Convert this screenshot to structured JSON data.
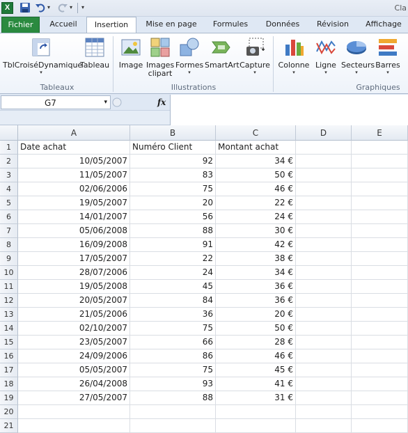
{
  "app": {
    "window_title_fragment": "Cla",
    "excel_icon_letter": "X"
  },
  "tabs": [
    {
      "label": "Fichier"
    },
    {
      "label": "Accueil"
    },
    {
      "label": "Insertion"
    },
    {
      "label": "Mise en page"
    },
    {
      "label": "Formules"
    },
    {
      "label": "Données"
    },
    {
      "label": "Révision"
    },
    {
      "label": "Affichage"
    }
  ],
  "ribbon": {
    "groups": {
      "tableaux": "Tableaux",
      "illustrations": "Illustrations",
      "graphiques": "Graphiques"
    },
    "buttons": {
      "pivot": "TblCroiséDynamique",
      "table": "Tableau",
      "image": "Image",
      "clipart_1": "Images",
      "clipart_2": "clipart",
      "shapes": "Formes",
      "smartart": "SmartArt",
      "capture": "Capture",
      "column": "Colonne",
      "line": "Ligne",
      "pie": "Secteurs",
      "bars": "Barres"
    }
  },
  "formula_bar": {
    "name_box": "G7",
    "fx_label": "fx",
    "formula": ""
  },
  "sheet": {
    "columns": [
      "A",
      "B",
      "C",
      "D",
      "E"
    ],
    "header_row": [
      "Date achat",
      "Numéro Client",
      "Montant achat"
    ],
    "rows": [
      [
        "10/05/2007",
        "92",
        "34 €"
      ],
      [
        "11/05/2007",
        "83",
        "50 €"
      ],
      [
        "02/06/2006",
        "75",
        "46 €"
      ],
      [
        "19/05/2007",
        "20",
        "22 €"
      ],
      [
        "14/01/2007",
        "56",
        "24 €"
      ],
      [
        "05/06/2008",
        "88",
        "30 €"
      ],
      [
        "16/09/2008",
        "91",
        "42 €"
      ],
      [
        "17/05/2007",
        "22",
        "38 €"
      ],
      [
        "28/07/2006",
        "24",
        "34 €"
      ],
      [
        "19/05/2008",
        "45",
        "36 €"
      ],
      [
        "20/05/2007",
        "84",
        "36 €"
      ],
      [
        "21/05/2006",
        "36",
        "20 €"
      ],
      [
        "02/10/2007",
        "75",
        "50 €"
      ],
      [
        "23/05/2007",
        "66",
        "28 €"
      ],
      [
        "24/09/2006",
        "86",
        "46 €"
      ],
      [
        "05/05/2007",
        "75",
        "45 €"
      ],
      [
        "26/04/2008",
        "93",
        "41 €"
      ],
      [
        "27/05/2007",
        "88",
        "31 €"
      ]
    ],
    "row_numbers": [
      "1",
      "2",
      "3",
      "4",
      "5",
      "6",
      "7",
      "8",
      "9",
      "10",
      "11",
      "12",
      "13",
      "14",
      "15",
      "16",
      "17",
      "18",
      "19",
      "20",
      "21"
    ]
  }
}
